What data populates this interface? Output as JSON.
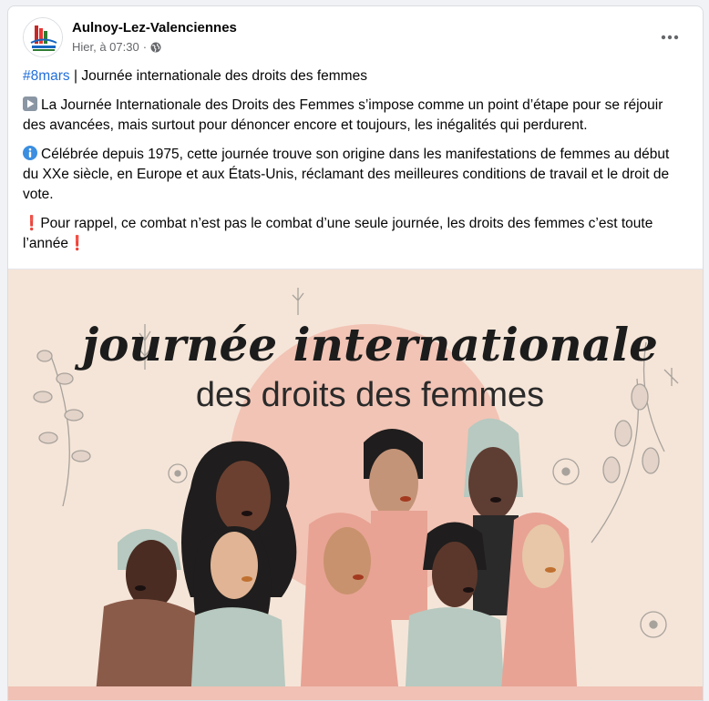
{
  "post": {
    "page_name": "Aulnoy-Lez-Valenciennes",
    "timestamp": "Hier, à 07:30",
    "separator": "·",
    "privacy_icon": "globe-icon",
    "more_icon": "more-options-icon",
    "more_label": "•••",
    "hashtag": "#8mars",
    "headline": " | Journée internationale des droits des femmes",
    "paragraph_1": "La Journée Internationale des Droits des Femmes s’impose comme un point d’étape pour se réjouir des avancées, mais surtout pour dénoncer encore et toujours, les inégalités qui perdurent.",
    "paragraph_2": "Célébrée depuis 1975, cette journée trouve son origine dans les manifestations de femmes au début du XXe siècle, en Europe et aux États-Unis, réclamant des meilleures conditions de travail et le droit de vote.",
    "paragraph_3": "Pour rappel, ce combat n’est pas le combat d’une seule journée, les droits des femmes c’est toute l’année",
    "exclamation": "❗"
  },
  "image": {
    "title_line_1": "journée internationale",
    "title_line_2": "des droits des femmes",
    "colors": {
      "background": "#f5e5d8",
      "sun": "#f2c4b5",
      "accent_pink": "#e8a394",
      "sage": "#b7c9c0",
      "text": "#1c1c1c"
    }
  }
}
